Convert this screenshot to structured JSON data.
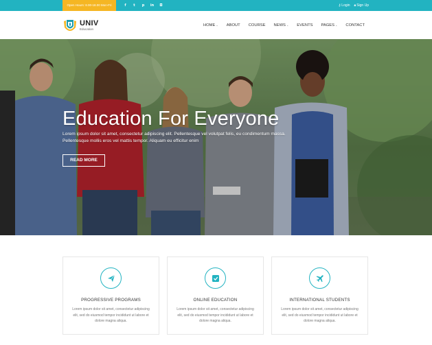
{
  "topbar": {
    "hours": "Open Hours: 8.00-18.00 Mon-Fri",
    "social_icons": [
      "facebook-icon",
      "twitter-icon",
      "pinterest-icon",
      "linkedin-icon",
      "instagram-icon"
    ],
    "social_glyphs": [
      "f",
      "t",
      "p",
      "in",
      "◘"
    ],
    "login": "Login",
    "signup": "Sign Up",
    "accent": "#22b3c1",
    "hours_bg": "#f5b623"
  },
  "header": {
    "logo_name": "UNIV",
    "logo_sub": "Education",
    "nav": [
      {
        "label": "HOME",
        "has_dropdown": true
      },
      {
        "label": "ABOUT",
        "has_dropdown": false
      },
      {
        "label": "COURSE",
        "has_dropdown": false
      },
      {
        "label": "NEWS",
        "has_dropdown": true
      },
      {
        "label": "EVENTS",
        "has_dropdown": false
      },
      {
        "label": "PAGES",
        "has_dropdown": true
      },
      {
        "label": "CONTACT",
        "has_dropdown": false
      }
    ]
  },
  "hero": {
    "title": "Education For Everyone",
    "text": "Lorem ipsum dolor sit amet, consectetur adipiscing elit. Pellentesque vel volutpat felis, eu condimentum massa. Pellentesque mollis eros vel mattis tempor. Aliquam eu efficitur enim",
    "button": "READ MORE"
  },
  "features": [
    {
      "icon": "paper-plane-icon",
      "title": "PROGRESSIVE PROGRAMS",
      "desc": "Lorem ipsum dolor sit amet, consectetur adipiscing elit, sed do eiusmod tempor incididunt ut labore et dolore magna aliqua."
    },
    {
      "icon": "checkbox-icon",
      "title": "ONLINE EDUCATION",
      "desc": "Lorem ipsum dolor sit amet, consectetur adipiscing elit, sed do eiusmod tempor incididunt ut labore et dolore magna aliqua."
    },
    {
      "icon": "airplane-icon",
      "title": "INTERNATIONAL STUDENTS",
      "desc": "Lorem ipsum dolor sit amet, consectetur adipiscing elit, sed do eiusmod tempor incididunt ut labore et dolore magna aliqua."
    }
  ]
}
